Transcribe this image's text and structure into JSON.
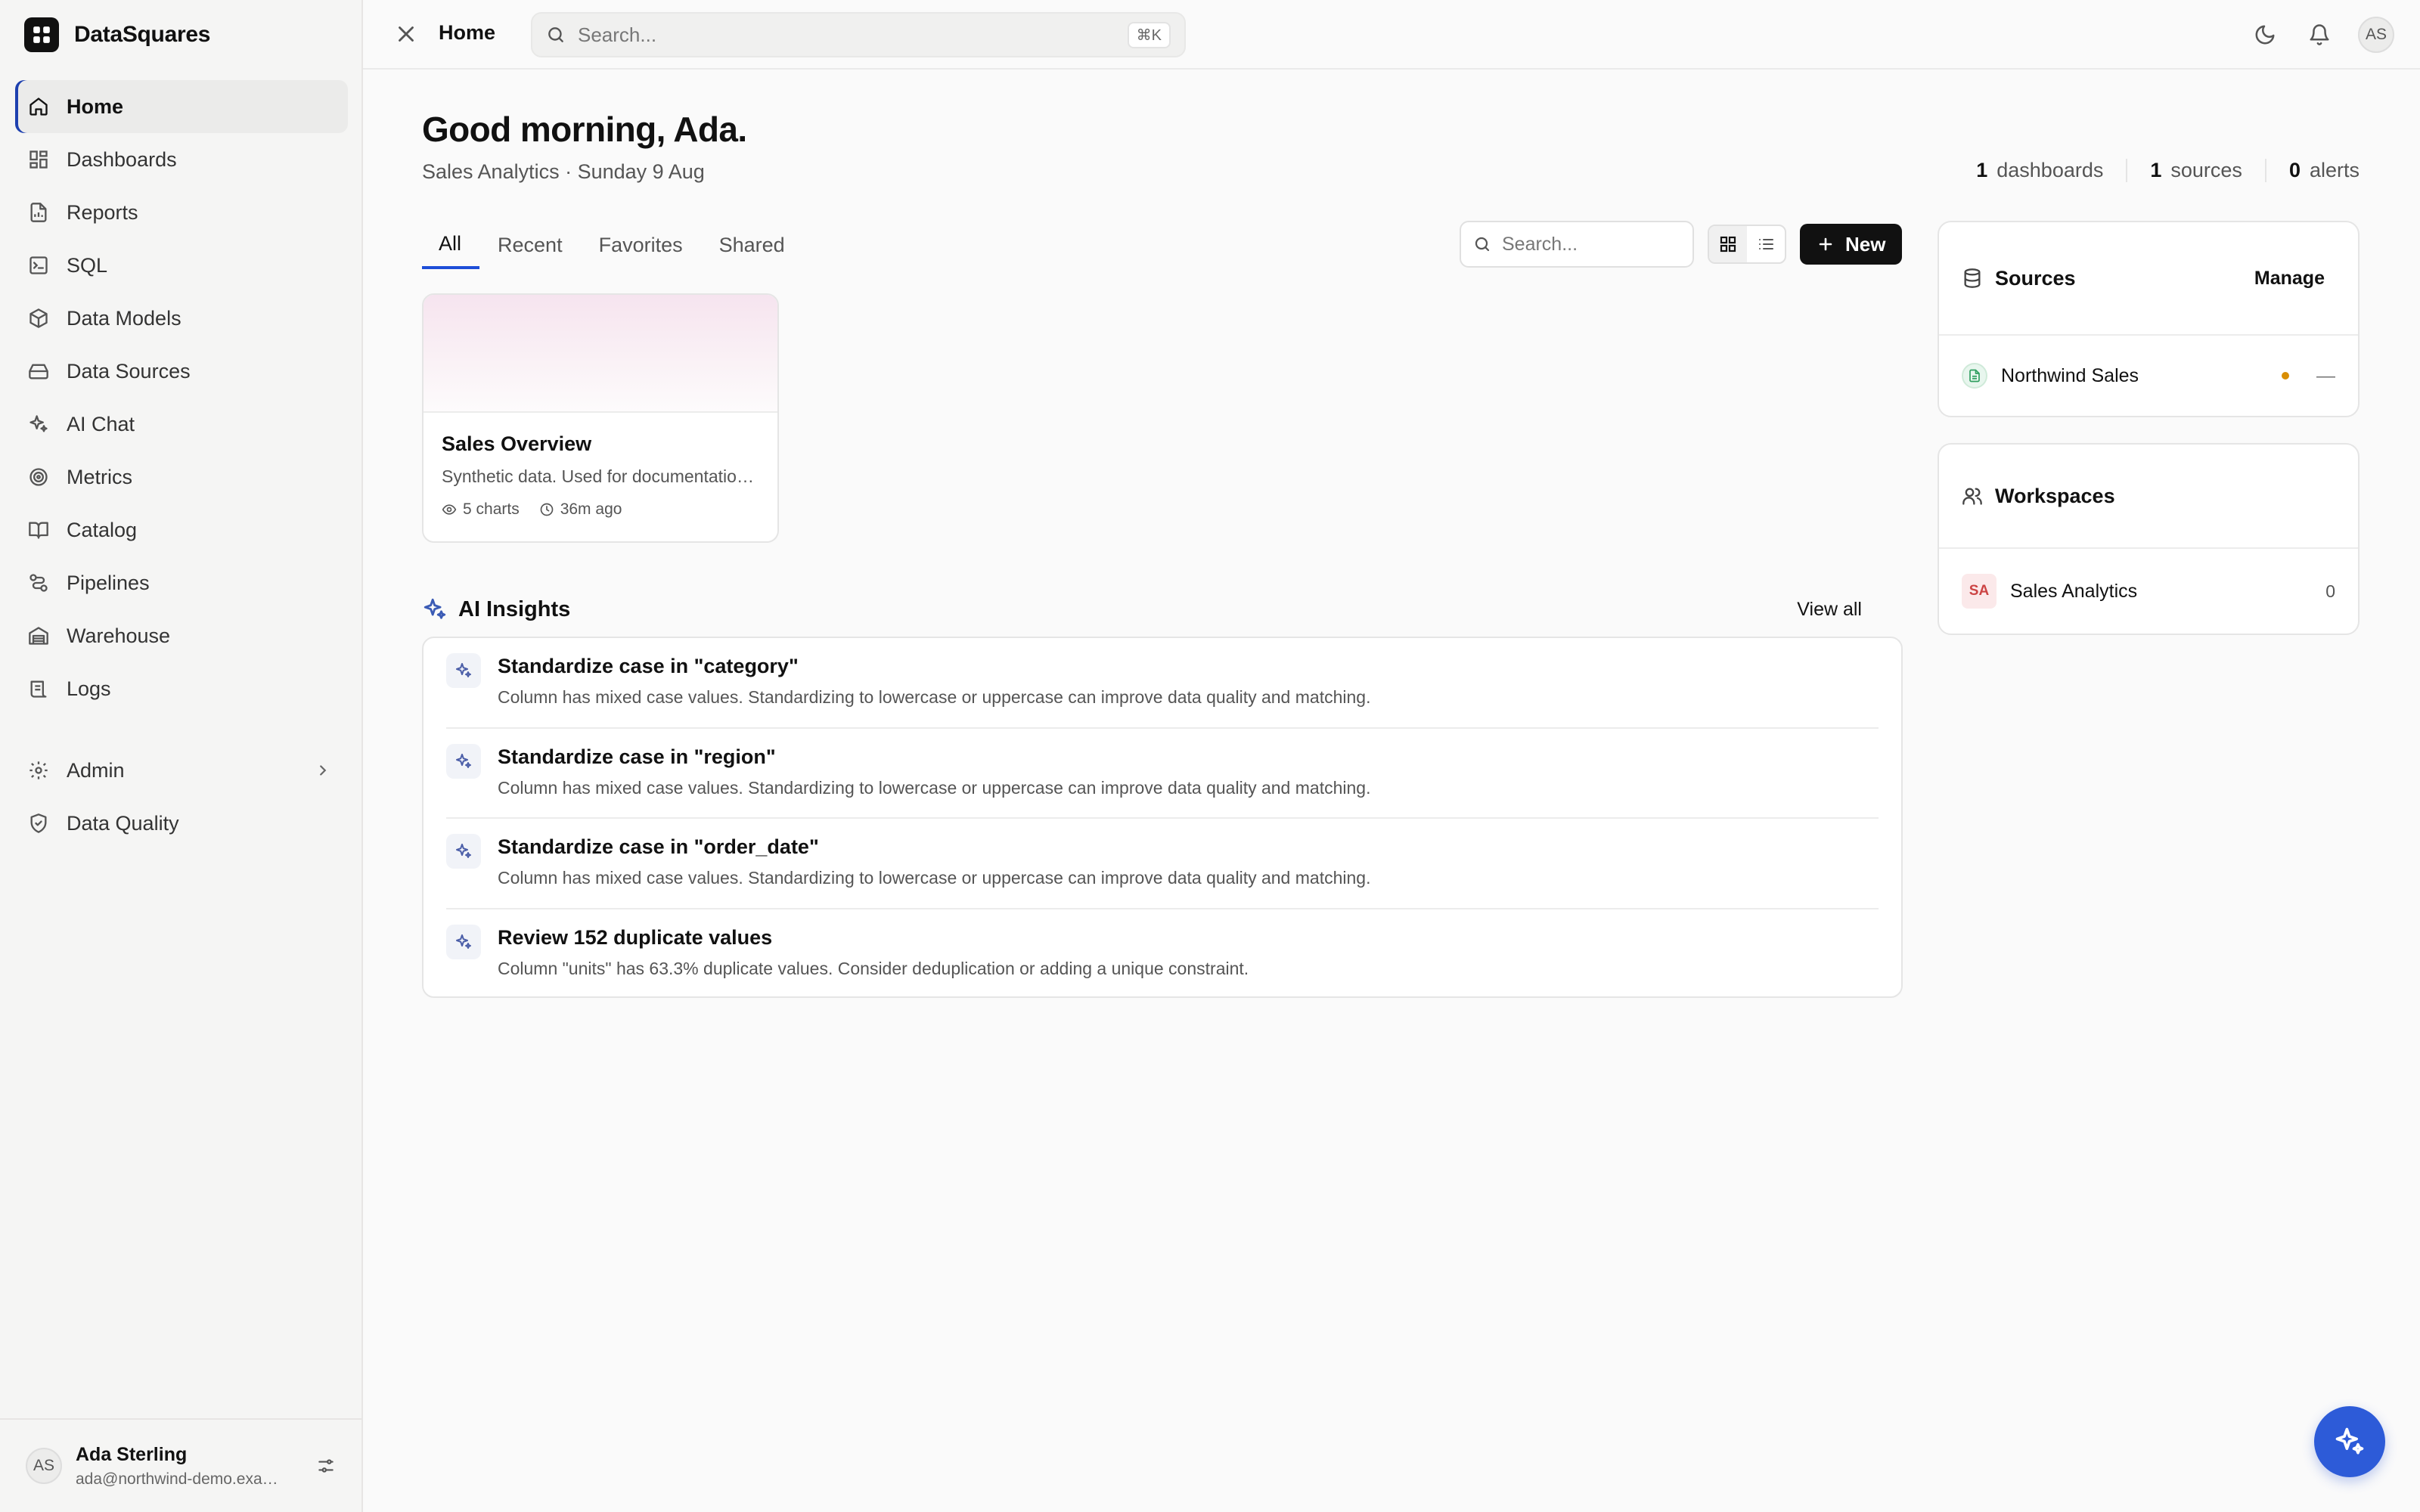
{
  "app": {
    "name": "DataSquares"
  },
  "sidebar": {
    "items": [
      {
        "label": "Home",
        "icon": "home-icon"
      },
      {
        "label": "Dashboards",
        "icon": "dashboard-icon"
      },
      {
        "label": "Reports",
        "icon": "report-icon"
      },
      {
        "label": "SQL",
        "icon": "terminal-icon"
      },
      {
        "label": "Data Models",
        "icon": "cube-icon"
      },
      {
        "label": "Data Sources",
        "icon": "drive-icon"
      },
      {
        "label": "AI Chat",
        "icon": "sparkles-icon"
      },
      {
        "label": "Metrics",
        "icon": "target-icon"
      },
      {
        "label": "Catalog",
        "icon": "book-icon"
      },
      {
        "label": "Pipelines",
        "icon": "workflow-icon"
      },
      {
        "label": "Warehouse",
        "icon": "warehouse-icon"
      },
      {
        "label": "Logs",
        "icon": "scroll-icon"
      }
    ],
    "secondary": [
      {
        "label": "Admin",
        "icon": "gear-icon"
      },
      {
        "label": "Data Quality",
        "icon": "shield-check-icon"
      }
    ],
    "user": {
      "initials": "AS",
      "name": "Ada Sterling",
      "email": "ada@northwind-demo.example.com"
    }
  },
  "topbar": {
    "breadcrumb": "Home",
    "search_placeholder": "Search...",
    "shortcut": "⌘K",
    "avatar_initials": "AS"
  },
  "main": {
    "greeting": "Good morning, Ada.",
    "subtitle": "Sales Analytics · Sunday 9 Aug",
    "stats": [
      {
        "value": "1",
        "label": "dashboards"
      },
      {
        "value": "1",
        "label": "sources"
      },
      {
        "value": "0",
        "label": "alerts"
      }
    ],
    "tabs": [
      "All",
      "Recent",
      "Favorites",
      "Shared"
    ],
    "search_placeholder": "Search...",
    "new_label": "New",
    "dashboard_card": {
      "title": "Sales Overview",
      "description": "Synthetic data. Used for documentation and demos.",
      "charts": "5 charts",
      "updated": "36m ago"
    },
    "ai_insights": {
      "title": "AI Insights",
      "view_all": "View all",
      "items": [
        {
          "title": "Standardize case in \"category\"",
          "description": "Column has mixed case values. Standardizing to lowercase or uppercase can improve data quality and matching."
        },
        {
          "title": "Standardize case in \"region\"",
          "description": "Column has mixed case values. Standardizing to lowercase or uppercase can improve data quality and matching."
        },
        {
          "title": "Standardize case in \"order_date\"",
          "description": "Column has mixed case values. Standardizing to lowercase or uppercase can improve data quality and matching."
        },
        {
          "title": "Review 152 duplicate values",
          "description": "Column \"units\" has 63.3% duplicate values. Consider deduplication or adding a unique constraint."
        }
      ]
    }
  },
  "panels": {
    "sources": {
      "title": "Sources",
      "action": "Manage",
      "items": [
        {
          "name": "Northwind Sales",
          "status": "—"
        }
      ]
    },
    "workspaces": {
      "title": "Workspaces",
      "items": [
        {
          "badge": "SA",
          "name": "Sales Analytics",
          "count": "0"
        }
      ]
    }
  },
  "colors": {
    "accent": "#1d4ed8",
    "fab": "#2d5bd8",
    "status_dot": "#d98e04"
  }
}
